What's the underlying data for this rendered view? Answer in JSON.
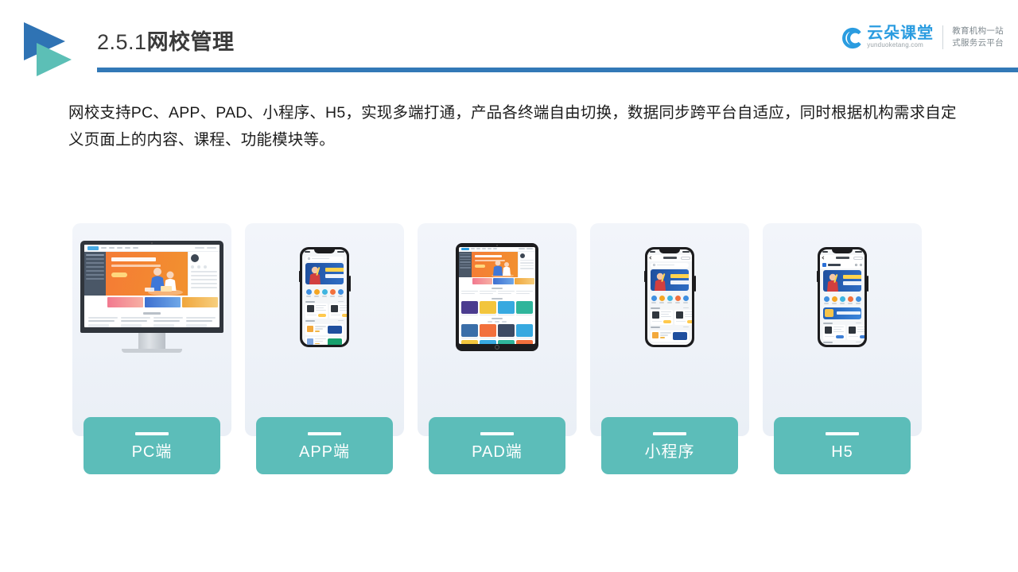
{
  "header": {
    "title_number": "2.5.1",
    "title_text": "网校管理",
    "rule_color": "#3279b7",
    "logo_blue": "#2f73b4",
    "logo_teal": "#5cbfb6"
  },
  "brand": {
    "name_cn": "云朵课堂",
    "domain": "yunduoketang.com",
    "tagline_line1": "教育机构一站",
    "tagline_line2": "式服务云平台",
    "color": "#2a9ce0"
  },
  "body": {
    "paragraph": "网校支持PC、APP、PAD、小程序、H5，实现多端打通，产品各终端自由切换，数据同步跨平台自适应，同时根据机构需求自定义页面上的内容、课程、功能模块等。"
  },
  "cards": [
    {
      "label": "PC端",
      "device": "desktop-monitor"
    },
    {
      "label": "APP端",
      "device": "smartphone"
    },
    {
      "label": "PAD端",
      "device": "tablet"
    },
    {
      "label": "小程序",
      "device": "smartphone-miniprogram"
    },
    {
      "label": "H5",
      "device": "smartphone-h5"
    }
  ],
  "theme": {
    "label_bg": "#5cbdb9",
    "label_text": "#ffffff",
    "card_bg": "#eef2f8",
    "page_bg": "#ffffff"
  }
}
